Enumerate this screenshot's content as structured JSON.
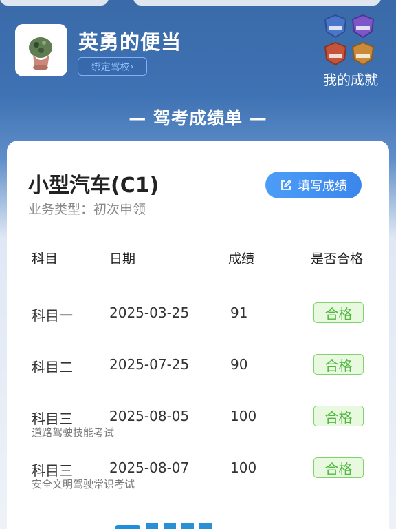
{
  "profile": {
    "name": "英勇的便当",
    "bind_label": "绑定驾校"
  },
  "achievements": {
    "label": "我的成就",
    "badge_colors": [
      "#4a76c9",
      "#7d56c9",
      "#c4553b",
      "#c98a3a"
    ]
  },
  "section_title": "— 驾考成绩单 —",
  "card": {
    "vehicle": "小型汽车(C1)",
    "business_type": "业务类型：初次申领",
    "fill_button": "填写成绩",
    "columns": [
      "科目",
      "日期",
      "成绩",
      "是否合格"
    ],
    "rows": [
      {
        "subject": "科目一",
        "date": "2025-03-25",
        "score": "91",
        "result": "合格",
        "note": ""
      },
      {
        "subject": "科目二",
        "date": "2025-07-25",
        "score": "90",
        "result": "合格",
        "note": ""
      },
      {
        "subject": "科目三",
        "date": "2025-08-05",
        "score": "100",
        "result": "合格",
        "note": "道路驾驶技能考试"
      },
      {
        "subject": "科目三",
        "date": "2025-08-07",
        "score": "100",
        "result": "合格",
        "note": "安全文明驾驶常识考试"
      }
    ]
  }
}
